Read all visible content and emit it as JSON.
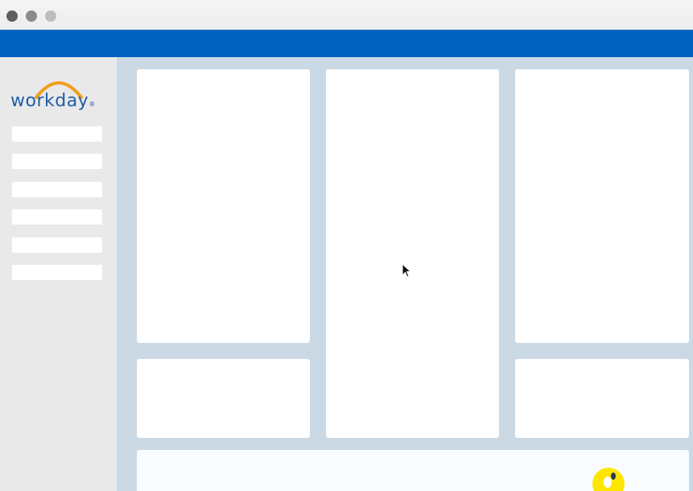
{
  "window": {
    "controls": [
      "close",
      "minimize",
      "zoom"
    ]
  },
  "header": {
    "bar_color": "#0063c1"
  },
  "sidebar": {
    "logo": {
      "text": "workday",
      "trademark": "®",
      "arc_color": "#f19e1f",
      "text_color": "#1f5ea8"
    },
    "items": [
      {
        "label": ""
      },
      {
        "label": ""
      },
      {
        "label": ""
      },
      {
        "label": ""
      },
      {
        "label": ""
      },
      {
        "label": ""
      }
    ]
  },
  "dashboard": {
    "background_color": "#cbd9e4",
    "cards": [
      {
        "id": "top-left"
      },
      {
        "id": "center-tall"
      },
      {
        "id": "top-right"
      },
      {
        "id": "bottom-left"
      },
      {
        "id": "bottom-right"
      },
      {
        "id": "footer-wide"
      }
    ]
  },
  "colors": {
    "accent": "#0063c1",
    "sidebar": "#e9e9e9",
    "highlight": "#ffe600"
  }
}
